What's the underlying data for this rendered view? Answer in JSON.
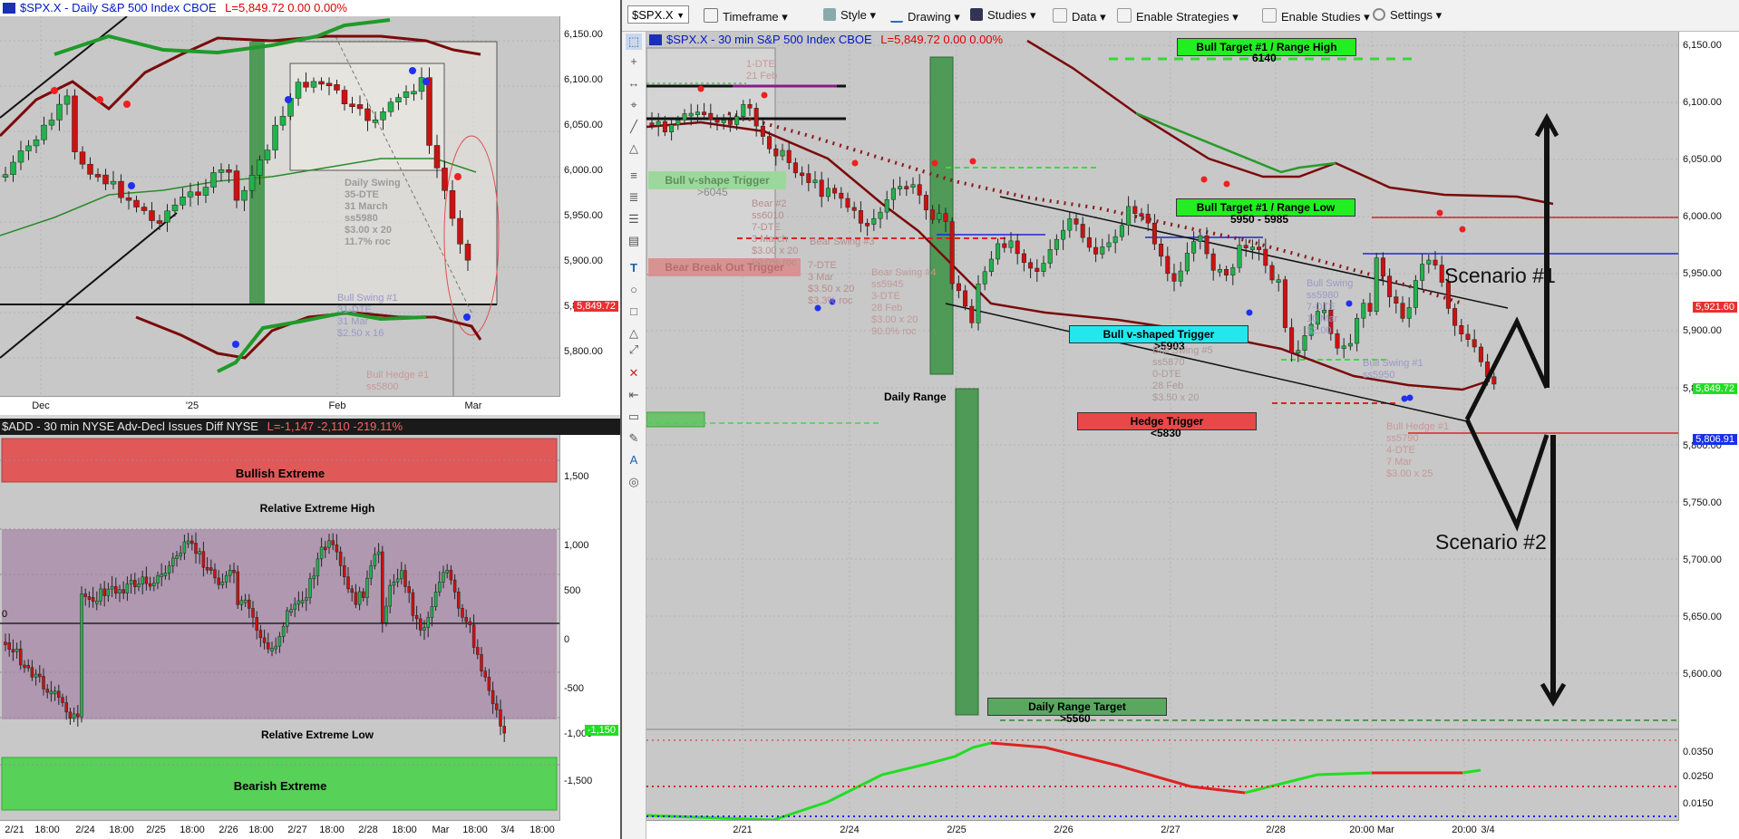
{
  "daily_chart": {
    "header": {
      "symbol": "$SPX.X - Daily  S&P 500 Index  CBOE",
      "last": "L=5,849.72  0.00  0.00%"
    },
    "yaxis": [
      "6,150.00",
      "6,100.00",
      "6,050.00",
      "6,000.00",
      "5,950.00",
      "5,900.00",
      "5,850.00",
      "5,800.00"
    ],
    "xaxis": [
      "Dec",
      "'25",
      "Feb",
      "Mar"
    ],
    "price_tag": "5,849.72",
    "notes": {
      "daily_swing": "Daily Swing\n35-DTE\n31 March\nss5980\n$3.00 x 20\n11.7% roc",
      "bull_swing": "Bull Swing #1\n31-DTE\n31 Mar\n$2.50 x 16",
      "bull_hedge": "Bull Hedge #1\nss5800"
    }
  },
  "add_chart": {
    "header": {
      "symbol": "$ADD - 30 min  NYSE Adv-Decl Issues Diff  NYSE",
      "last": "L=-1,147  -2,110  -219.11%"
    },
    "yaxis": [
      "1,500",
      "1,000",
      "500",
      "0",
      "-500",
      "-1,000",
      "-1,500"
    ],
    "xaxis": [
      "2/21",
      "18:00",
      "2/24",
      "18:00",
      "2/25",
      "18:00",
      "2/26",
      "18:00",
      "2/27",
      "18:00",
      "2/28",
      "18:00",
      "Mar",
      "18:00",
      "3/4",
      "18:00"
    ],
    "zero_label": "0",
    "value_tag": "-1,150",
    "bands": {
      "bullish_extreme": "Bullish Extreme",
      "relative_high": "Relative Extreme High",
      "relative_low": "Relative Extreme Low",
      "bearish_extreme": "Bearish Extreme"
    }
  },
  "toolbar": {
    "symbol": "$SPX.X",
    "items": [
      "Timeframe",
      "Style",
      "Drawing",
      "Studies",
      "Data",
      "Enable Strategies",
      "Enable Studies",
      "Settings"
    ]
  },
  "main_chart": {
    "header": {
      "symbol": "$SPX.X - 30 min  S&P 500 Index  CBOE",
      "last": "L=5,849.72  0.00  0.00%"
    },
    "yaxis": [
      "6,150.00",
      "6,100.00",
      "6,050.00",
      "6,000.00",
      "5,950.00",
      "5,900.00",
      "5,850.00",
      "5,800.00",
      "5,750.00",
      "5,700.00",
      "5,650.00",
      "5,600.00"
    ],
    "lower_yaxis": [
      "0.0350",
      "0.0250",
      "0.0150"
    ],
    "xaxis": [
      "2/21",
      "2/24",
      "2/25",
      "2/26",
      "2/27",
      "2/28",
      "20:00 Mar",
      "20:00",
      "3/4"
    ],
    "tags": {
      "p1": "5,921.60",
      "p2": "5,849.72",
      "p3": "5,806.91"
    },
    "labels": {
      "bull_target_high": "Bull Target #1 / Range High",
      "bull_target_high_sub": "6140",
      "bull_target_low": "Bull Target #1 / Range Low",
      "bull_target_low_sub": "5950 - 5985",
      "bull_v_trigger": "Bull v-shaped Trigger",
      "bull_v_trigger_sub": ">5903",
      "hedge_trigger": "Hedge Trigger",
      "hedge_trigger_sub": "<5830",
      "daily_range_target": "Daily Range Target",
      "daily_range_target_sub": ">5560",
      "daily_range": "Daily Range",
      "bull_v_left": "Bull v-shape Trigger",
      "bull_v_left_sub": ">6045",
      "bear_breakout": "Bear Break Out Trigger",
      "scenario1": "Scenario #1",
      "scenario2": "Scenario #2"
    },
    "notes": {
      "dte_top": "1-DTE\n21 Feb",
      "bear2": "Bear #2\nss6010\n7-DTE\n3 March\n$3.00 x 20\n90.0% roc",
      "bear_swing3": "Bear Swing #3",
      "bear_swing_mid": "7-DTE\n3 Mar\n$3.50 x 20\n$3.3% roc",
      "bear_swing_b": "Bear Swing #4\nss5945\n3-DTE\n28 Feb\n$3.00 x 20\n90.0% roc",
      "bull_swing5": "Bull Swing #5\nss5870\n0-DTE\n28 Feb\n$3.50 x 20",
      "bull_swing_r": "Bull Swing\nss5980\n7-DTE\n10 Mar\n$2.00",
      "bull_swing1": "Bull Swing #1\nss5950",
      "bull_hedge1": "Bull Hedge #1\nss5790\n4-DTE\n7 Mar\n$3.00 x 25"
    }
  },
  "colors": {
    "up": "#22b24c",
    "down": "#cc1111",
    "ma_dark": "#7a0a0a",
    "band_green": "#1f9a2a",
    "bullish_band": "#e05858",
    "bearish_band": "#57d157",
    "relative_zone": "#a888a8"
  }
}
